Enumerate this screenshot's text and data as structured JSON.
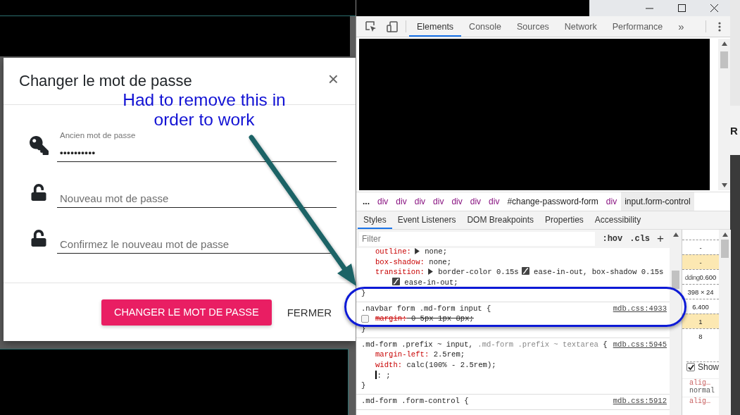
{
  "dialog": {
    "title": "Changer le mot de passe",
    "close": "×",
    "fields": [
      {
        "kind": "current",
        "label": "Ancien mot de passe",
        "value": "••••••••••"
      },
      {
        "kind": "new",
        "placeholder": "Nouveau mot de passe"
      },
      {
        "kind": "confirm",
        "placeholder": "Confirmez le nouveau mot de passe"
      }
    ],
    "buttons": [
      {
        "kind": "primary",
        "label": "CHANGER LE MOT DE PASSE"
      },
      {
        "kind": "flat",
        "label": "FERMER"
      }
    ]
  },
  "annotation": {
    "text": "Had to remove this in order to work"
  },
  "page_fragment": "R",
  "devtools": {
    "tabs": [
      {
        "label": "Elements",
        "selected": true
      },
      {
        "label": "Console",
        "selected": false
      },
      {
        "label": "Sources",
        "selected": false
      },
      {
        "label": "Network",
        "selected": false
      },
      {
        "label": "Performance",
        "selected": false
      }
    ],
    "more_tabs": "»",
    "breadcrumbs": [
      {
        "kind": "more",
        "label": "...",
        "selected": false
      },
      {
        "kind": "tag",
        "label": "div",
        "selected": false
      },
      {
        "kind": "tag",
        "label": "div",
        "selected": false
      },
      {
        "kind": "tag",
        "label": "div",
        "selected": false
      },
      {
        "kind": "tag",
        "label": "div",
        "selected": false
      },
      {
        "kind": "tag",
        "label": "div",
        "selected": false
      },
      {
        "kind": "tag",
        "label": "div",
        "selected": false
      },
      {
        "kind": "tag",
        "label": "div",
        "selected": false
      },
      {
        "kind": "selector",
        "label": "#change-password-form",
        "selected": false
      },
      {
        "kind": "tag",
        "label": "div",
        "selected": false
      },
      {
        "kind": "selector",
        "label": "input.form-control",
        "selected": true
      }
    ],
    "subtabs": [
      {
        "label": "Styles",
        "selected": true
      },
      {
        "label": "Event Listeners",
        "selected": false
      },
      {
        "label": "DOM Breakpoints",
        "selected": false
      },
      {
        "label": "Properties",
        "selected": false
      },
      {
        "label": "Accessibility",
        "selected": false
      }
    ],
    "styles": {
      "filter_placeholder": "Filter",
      "hov": ":hov",
      "cls": ".cls",
      "add": "+",
      "rules": [
        {
          "close": "}",
          "properties": [
            {
              "kind": "property",
              "name": "outline:",
              "enabled": true,
              "value": [
                {
                  "kind": "expander"
                },
                {
                  "kind": "text",
                  "text": "none;"
                }
              ]
            },
            {
              "kind": "property",
              "name": "box-shadow:",
              "enabled": true,
              "value": [
                {
                  "kind": "text",
                  "text": "none;"
                }
              ]
            },
            {
              "kind": "property",
              "name": "transition:",
              "enabled": true,
              "value": [
                {
                  "kind": "expander"
                },
                {
                  "kind": "text",
                  "text": "border-color 0.15s"
                },
                {
                  "kind": "easing"
                },
                {
                  "kind": "text",
                  "text": "ease-in-out, box-shadow 0.15s"
                },
                {
                  "kind": "easing"
                },
                {
                  "kind": "text",
                  "text": "ease-in-out;"
                }
              ]
            }
          ]
        },
        {
          "selector": [
            {
              "text": ".navbar form .md-form input",
              "matched": true
            }
          ],
          "open": "{",
          "close": "}",
          "source": "mdb.css:4933",
          "properties": [
            {
              "kind": "property",
              "name": "margin:",
              "enabled": false,
              "value": [
                {
                  "kind": "text",
                  "text": "0 5px 1px 8px;"
                }
              ]
            }
          ]
        },
        {
          "selector": [
            {
              "text": ".md-form .prefix ~ input,",
              "matched": true
            },
            {
              "text": ".md-form .prefix ~ textarea",
              "matched": false
            }
          ],
          "open": "{",
          "close": "}",
          "source": "mdb.css:5945",
          "properties": [
            {
              "kind": "property",
              "name": "margin-left:",
              "enabled": true,
              "value": [
                {
                  "kind": "text",
                  "text": "2.5rem;"
                }
              ]
            },
            {
              "kind": "property",
              "name": "width:",
              "enabled": true,
              "value": [
                {
                  "kind": "text",
                  "text": "calc(100% - 2.5rem);"
                }
              ]
            },
            {
              "kind": "editing",
              "text": ": ;"
            }
          ]
        },
        {
          "selector": [
            {
              "text": ".md-form .form-control",
              "matched": true
            }
          ],
          "open": "{",
          "source": "mdb.css:5912"
        }
      ]
    },
    "computed": {
      "box_model": [
        {
          "text": "-",
          "highlighted": false
        },
        {
          "text": "-",
          "highlighted": true
        },
        {
          "prefix": "dding",
          "text": "0.600",
          "highlighted": false
        },
        {
          "text": "398 × 24",
          "highlighted": false
        },
        {
          "text": "6.400",
          "highlighted": false
        },
        {
          "text": "1",
          "highlighted": true
        },
        {
          "text": "8",
          "highlighted": false
        }
      ],
      "show_all": {
        "label": "Show",
        "checked": true
      },
      "properties": [
        {
          "name": "alig…",
          "value": "normal"
        },
        {
          "name": "alig…"
        }
      ]
    }
  }
}
